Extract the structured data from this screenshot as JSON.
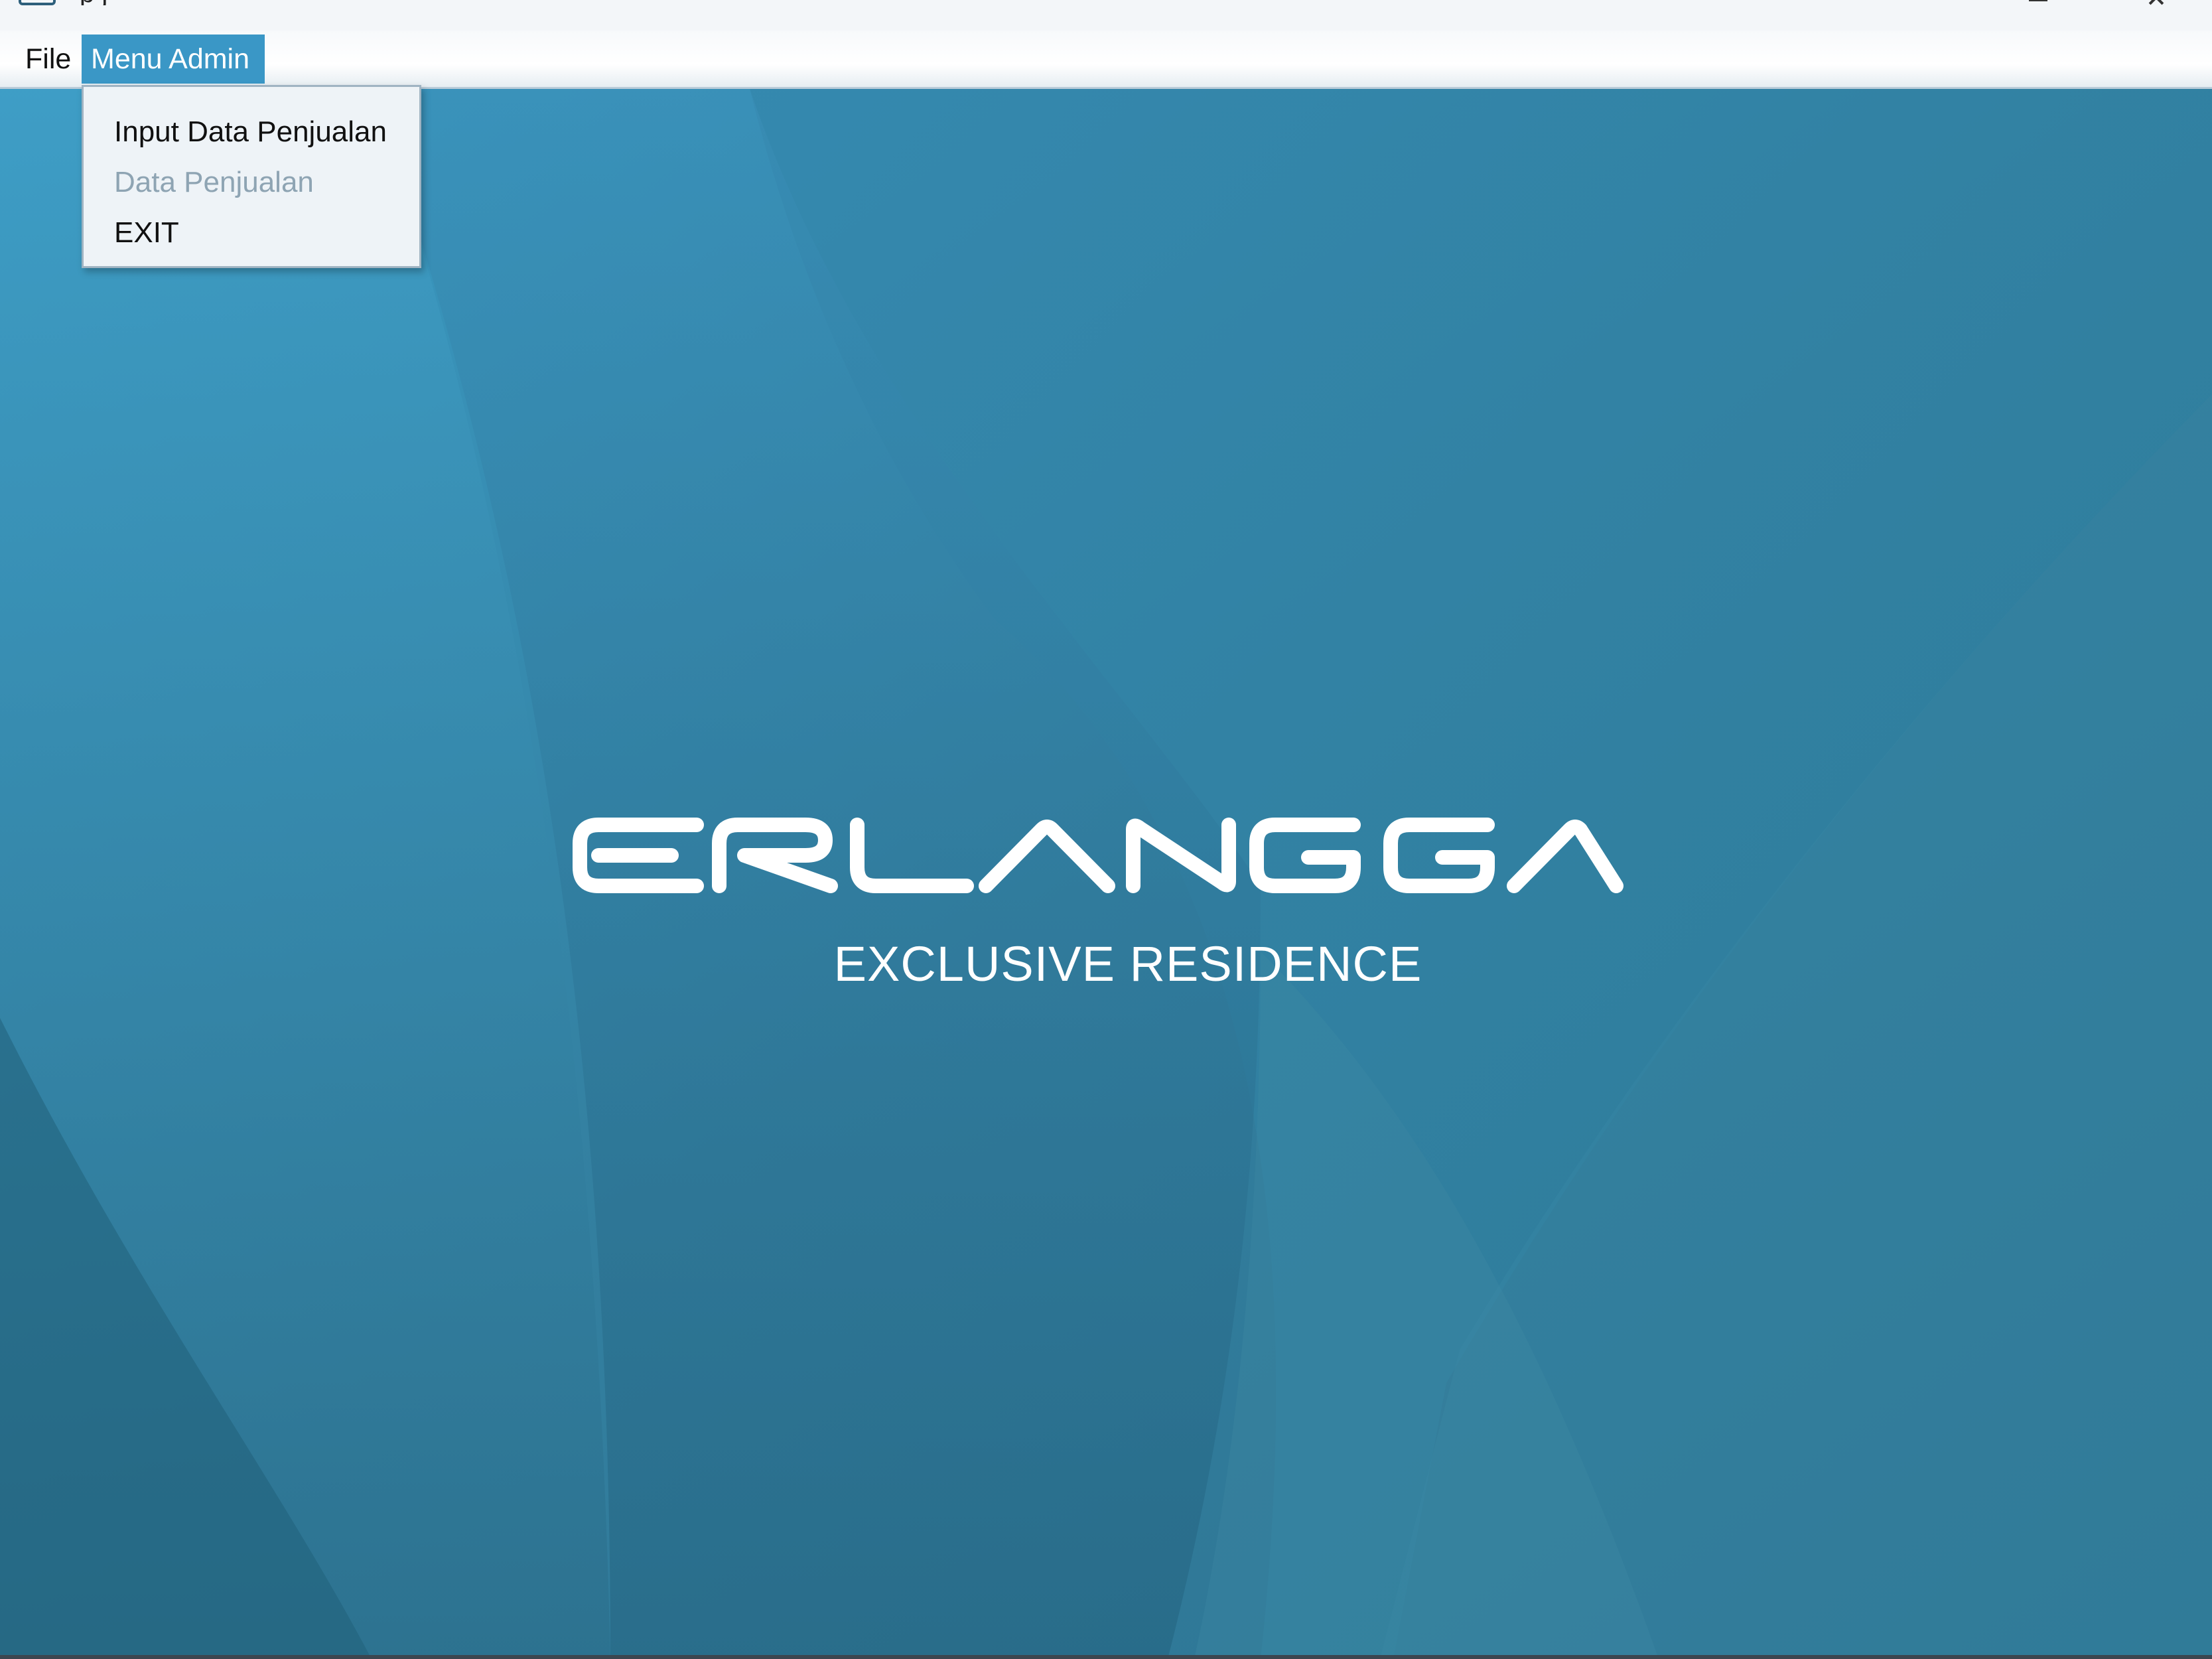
{
  "window": {
    "title_fragment": "p        j"
  },
  "menubar": {
    "items": [
      {
        "label": "File"
      },
      {
        "label": "Menu Admin"
      }
    ]
  },
  "dropdown": {
    "items": [
      {
        "label": "Input Data Penjualan",
        "enabled": true
      },
      {
        "label": "Data Penjualan",
        "enabled": false
      },
      {
        "label": "EXIT",
        "enabled": true
      }
    ]
  },
  "branding": {
    "logo_text": "ERLANGGA",
    "tagline": "EXCLUSIVE RESIDENCE"
  },
  "colors": {
    "background": "#2f7e9e",
    "menu_highlight": "#3a97c6",
    "logo": "#ffffff"
  }
}
